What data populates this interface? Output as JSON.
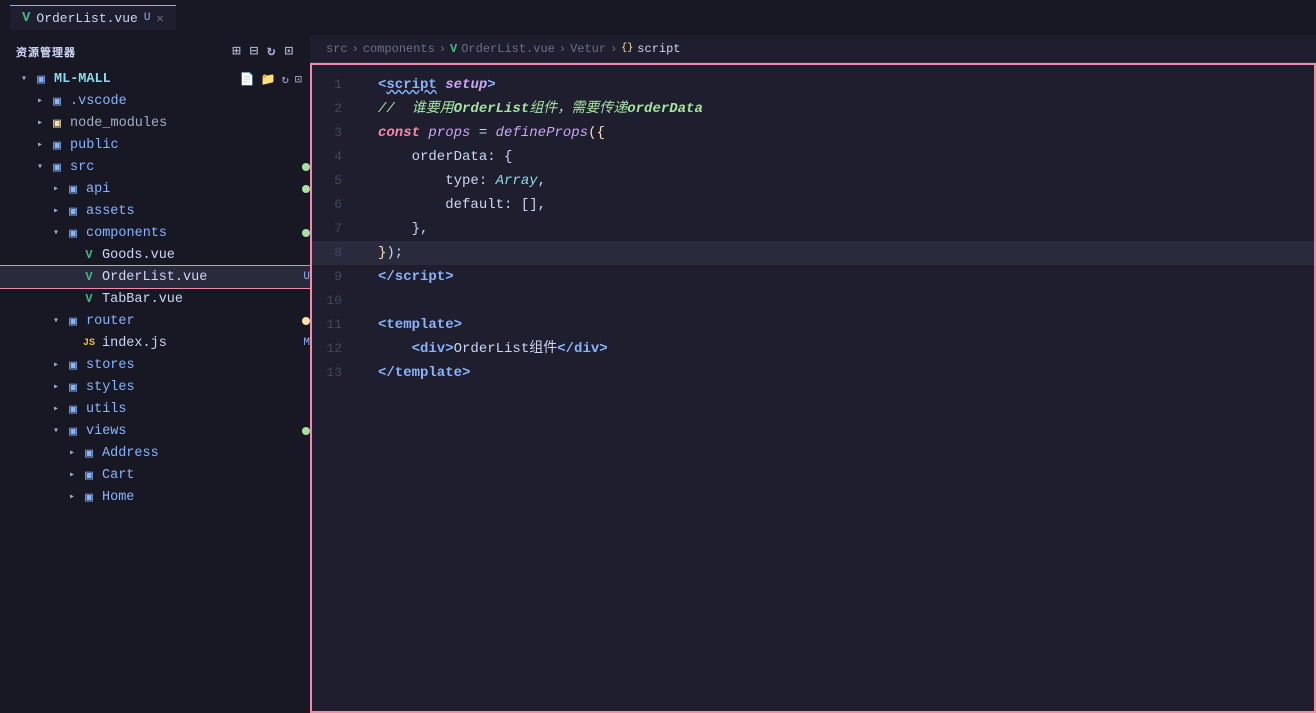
{
  "titleBar": {
    "tabs": [
      {
        "id": "orderlist-tab",
        "vueIcon": "V",
        "label": "OrderList.vue",
        "modified": "U",
        "closable": true
      }
    ]
  },
  "breadcrumb": {
    "parts": [
      "src",
      ">",
      "components",
      ">",
      "OrderList.vue",
      ">",
      "Vetur",
      ">",
      "script"
    ]
  },
  "sidebar": {
    "title": "资源管理器",
    "moreIcon": "•••",
    "root": {
      "label": "ML-MALL",
      "icons": [
        "new-file",
        "new-folder",
        "refresh",
        "collapse"
      ]
    },
    "items": [
      {
        "id": "vscode",
        "indent": 1,
        "type": "folder",
        "arrow": "closed",
        "label": ".vscode",
        "badge": ""
      },
      {
        "id": "node-modules",
        "indent": 1,
        "type": "folder",
        "arrow": "closed",
        "label": "node_modules",
        "badge": ""
      },
      {
        "id": "public",
        "indent": 1,
        "type": "folder",
        "arrow": "closed",
        "label": "public",
        "badge": ""
      },
      {
        "id": "src",
        "indent": 1,
        "type": "folder",
        "arrow": "open",
        "label": "src",
        "badge": "green"
      },
      {
        "id": "api",
        "indent": 2,
        "type": "folder",
        "arrow": "closed",
        "label": "api",
        "badge": "green"
      },
      {
        "id": "assets",
        "indent": 2,
        "type": "folder",
        "arrow": "closed",
        "label": "assets",
        "badge": ""
      },
      {
        "id": "components",
        "indent": 2,
        "type": "folder",
        "arrow": "open",
        "label": "components",
        "badge": "green"
      },
      {
        "id": "goods-vue",
        "indent": 3,
        "type": "vue",
        "arrow": "none",
        "label": "Goods.vue",
        "badge": ""
      },
      {
        "id": "orderlist-vue",
        "indent": 3,
        "type": "vue",
        "arrow": "none",
        "label": "OrderList.vue",
        "badge": "U",
        "active": true
      },
      {
        "id": "tabbar-vue",
        "indent": 3,
        "type": "vue",
        "arrow": "none",
        "label": "TabBar.vue",
        "badge": ""
      },
      {
        "id": "router",
        "indent": 2,
        "type": "folder",
        "arrow": "open",
        "label": "router",
        "badge": "yellow"
      },
      {
        "id": "index-js",
        "indent": 3,
        "type": "js",
        "arrow": "none",
        "label": "index.js",
        "badge": "M"
      },
      {
        "id": "stores",
        "indent": 2,
        "type": "folder",
        "arrow": "closed",
        "label": "stores",
        "badge": ""
      },
      {
        "id": "styles",
        "indent": 2,
        "type": "folder",
        "arrow": "closed",
        "label": "styles",
        "badge": ""
      },
      {
        "id": "utils",
        "indent": 2,
        "type": "folder",
        "arrow": "closed",
        "label": "utils",
        "badge": ""
      },
      {
        "id": "views",
        "indent": 2,
        "type": "folder",
        "arrow": "open",
        "label": "views",
        "badge": "green"
      },
      {
        "id": "address",
        "indent": 3,
        "type": "folder",
        "arrow": "closed",
        "label": "Address",
        "badge": ""
      },
      {
        "id": "cart",
        "indent": 3,
        "type": "folder",
        "arrow": "closed",
        "label": "Cart",
        "badge": ""
      },
      {
        "id": "home",
        "indent": 3,
        "type": "folder",
        "arrow": "closed",
        "label": "Home",
        "badge": ""
      }
    ]
  },
  "codeEditor": {
    "lines": [
      {
        "num": 1,
        "tokens": [
          {
            "text": "<",
            "cls": "c-tag"
          },
          {
            "text": "script",
            "cls": "c-tag"
          },
          {
            "text": " ",
            "cls": "c-white"
          },
          {
            "text": "setup",
            "cls": "c-attr"
          },
          {
            "text": ">",
            "cls": "c-tag"
          }
        ]
      },
      {
        "num": 2,
        "tokens": [
          {
            "text": "// ",
            "cls": "c-comment"
          },
          {
            "text": "谁要用",
            "cls": "c-comment"
          },
          {
            "text": "OrderList",
            "cls": "c-comment"
          },
          {
            "text": "组件，需要传递",
            "cls": "c-comment"
          },
          {
            "text": "orderData",
            "cls": "c-comment"
          }
        ]
      },
      {
        "num": 3,
        "tokens": [
          {
            "text": "const",
            "cls": "c-const"
          },
          {
            "text": " ",
            "cls": "c-white"
          },
          {
            "text": "props",
            "cls": "c-props"
          },
          {
            "text": " = ",
            "cls": "c-white"
          },
          {
            "text": "defineProps",
            "cls": "c-func"
          },
          {
            "text": "({",
            "cls": "c-yellow"
          }
        ]
      },
      {
        "num": 4,
        "tokens": [
          {
            "text": "    orderData: {",
            "cls": "c-white"
          }
        ]
      },
      {
        "num": 5,
        "tokens": [
          {
            "text": "        type: ",
            "cls": "c-white"
          },
          {
            "text": "Array",
            "cls": "c-blue"
          },
          {
            "text": ",",
            "cls": "c-white"
          }
        ]
      },
      {
        "num": 6,
        "tokens": [
          {
            "text": "        default: ",
            "cls": "c-white"
          },
          {
            "text": "[]",
            "cls": "c-white"
          },
          {
            "text": ",",
            "cls": "c-white"
          }
        ]
      },
      {
        "num": 7,
        "tokens": [
          {
            "text": "    },",
            "cls": "c-white"
          }
        ]
      },
      {
        "num": 8,
        "tokens": [
          {
            "text": "}",
            "cls": "c-yellow"
          },
          {
            "text": ");",
            "cls": "c-white"
          }
        ],
        "active": true
      },
      {
        "num": 9,
        "tokens": [
          {
            "text": "<",
            "cls": "c-tag"
          },
          {
            "text": "/script",
            "cls": "c-tag"
          },
          {
            "text": ">",
            "cls": "c-tag"
          }
        ]
      },
      {
        "num": 10,
        "tokens": []
      },
      {
        "num": 11,
        "tokens": [
          {
            "text": "<",
            "cls": "c-tag"
          },
          {
            "text": "template",
            "cls": "c-tag"
          },
          {
            "text": ">",
            "cls": "c-tag"
          }
        ]
      },
      {
        "num": 12,
        "tokens": [
          {
            "text": "    <",
            "cls": "c-tag"
          },
          {
            "text": "div",
            "cls": "c-tag"
          },
          {
            "text": ">",
            "cls": "c-tag"
          },
          {
            "text": "OrderList组件",
            "cls": "c-white"
          },
          {
            "text": "</",
            "cls": "c-tag"
          },
          {
            "text": "div",
            "cls": "c-tag"
          },
          {
            "text": ">",
            "cls": "c-tag"
          }
        ]
      },
      {
        "num": 13,
        "tokens": [
          {
            "text": "<",
            "cls": "c-tag"
          },
          {
            "text": "/template",
            "cls": "c-tag"
          },
          {
            "text": ">",
            "cls": "c-tag"
          }
        ]
      }
    ]
  }
}
